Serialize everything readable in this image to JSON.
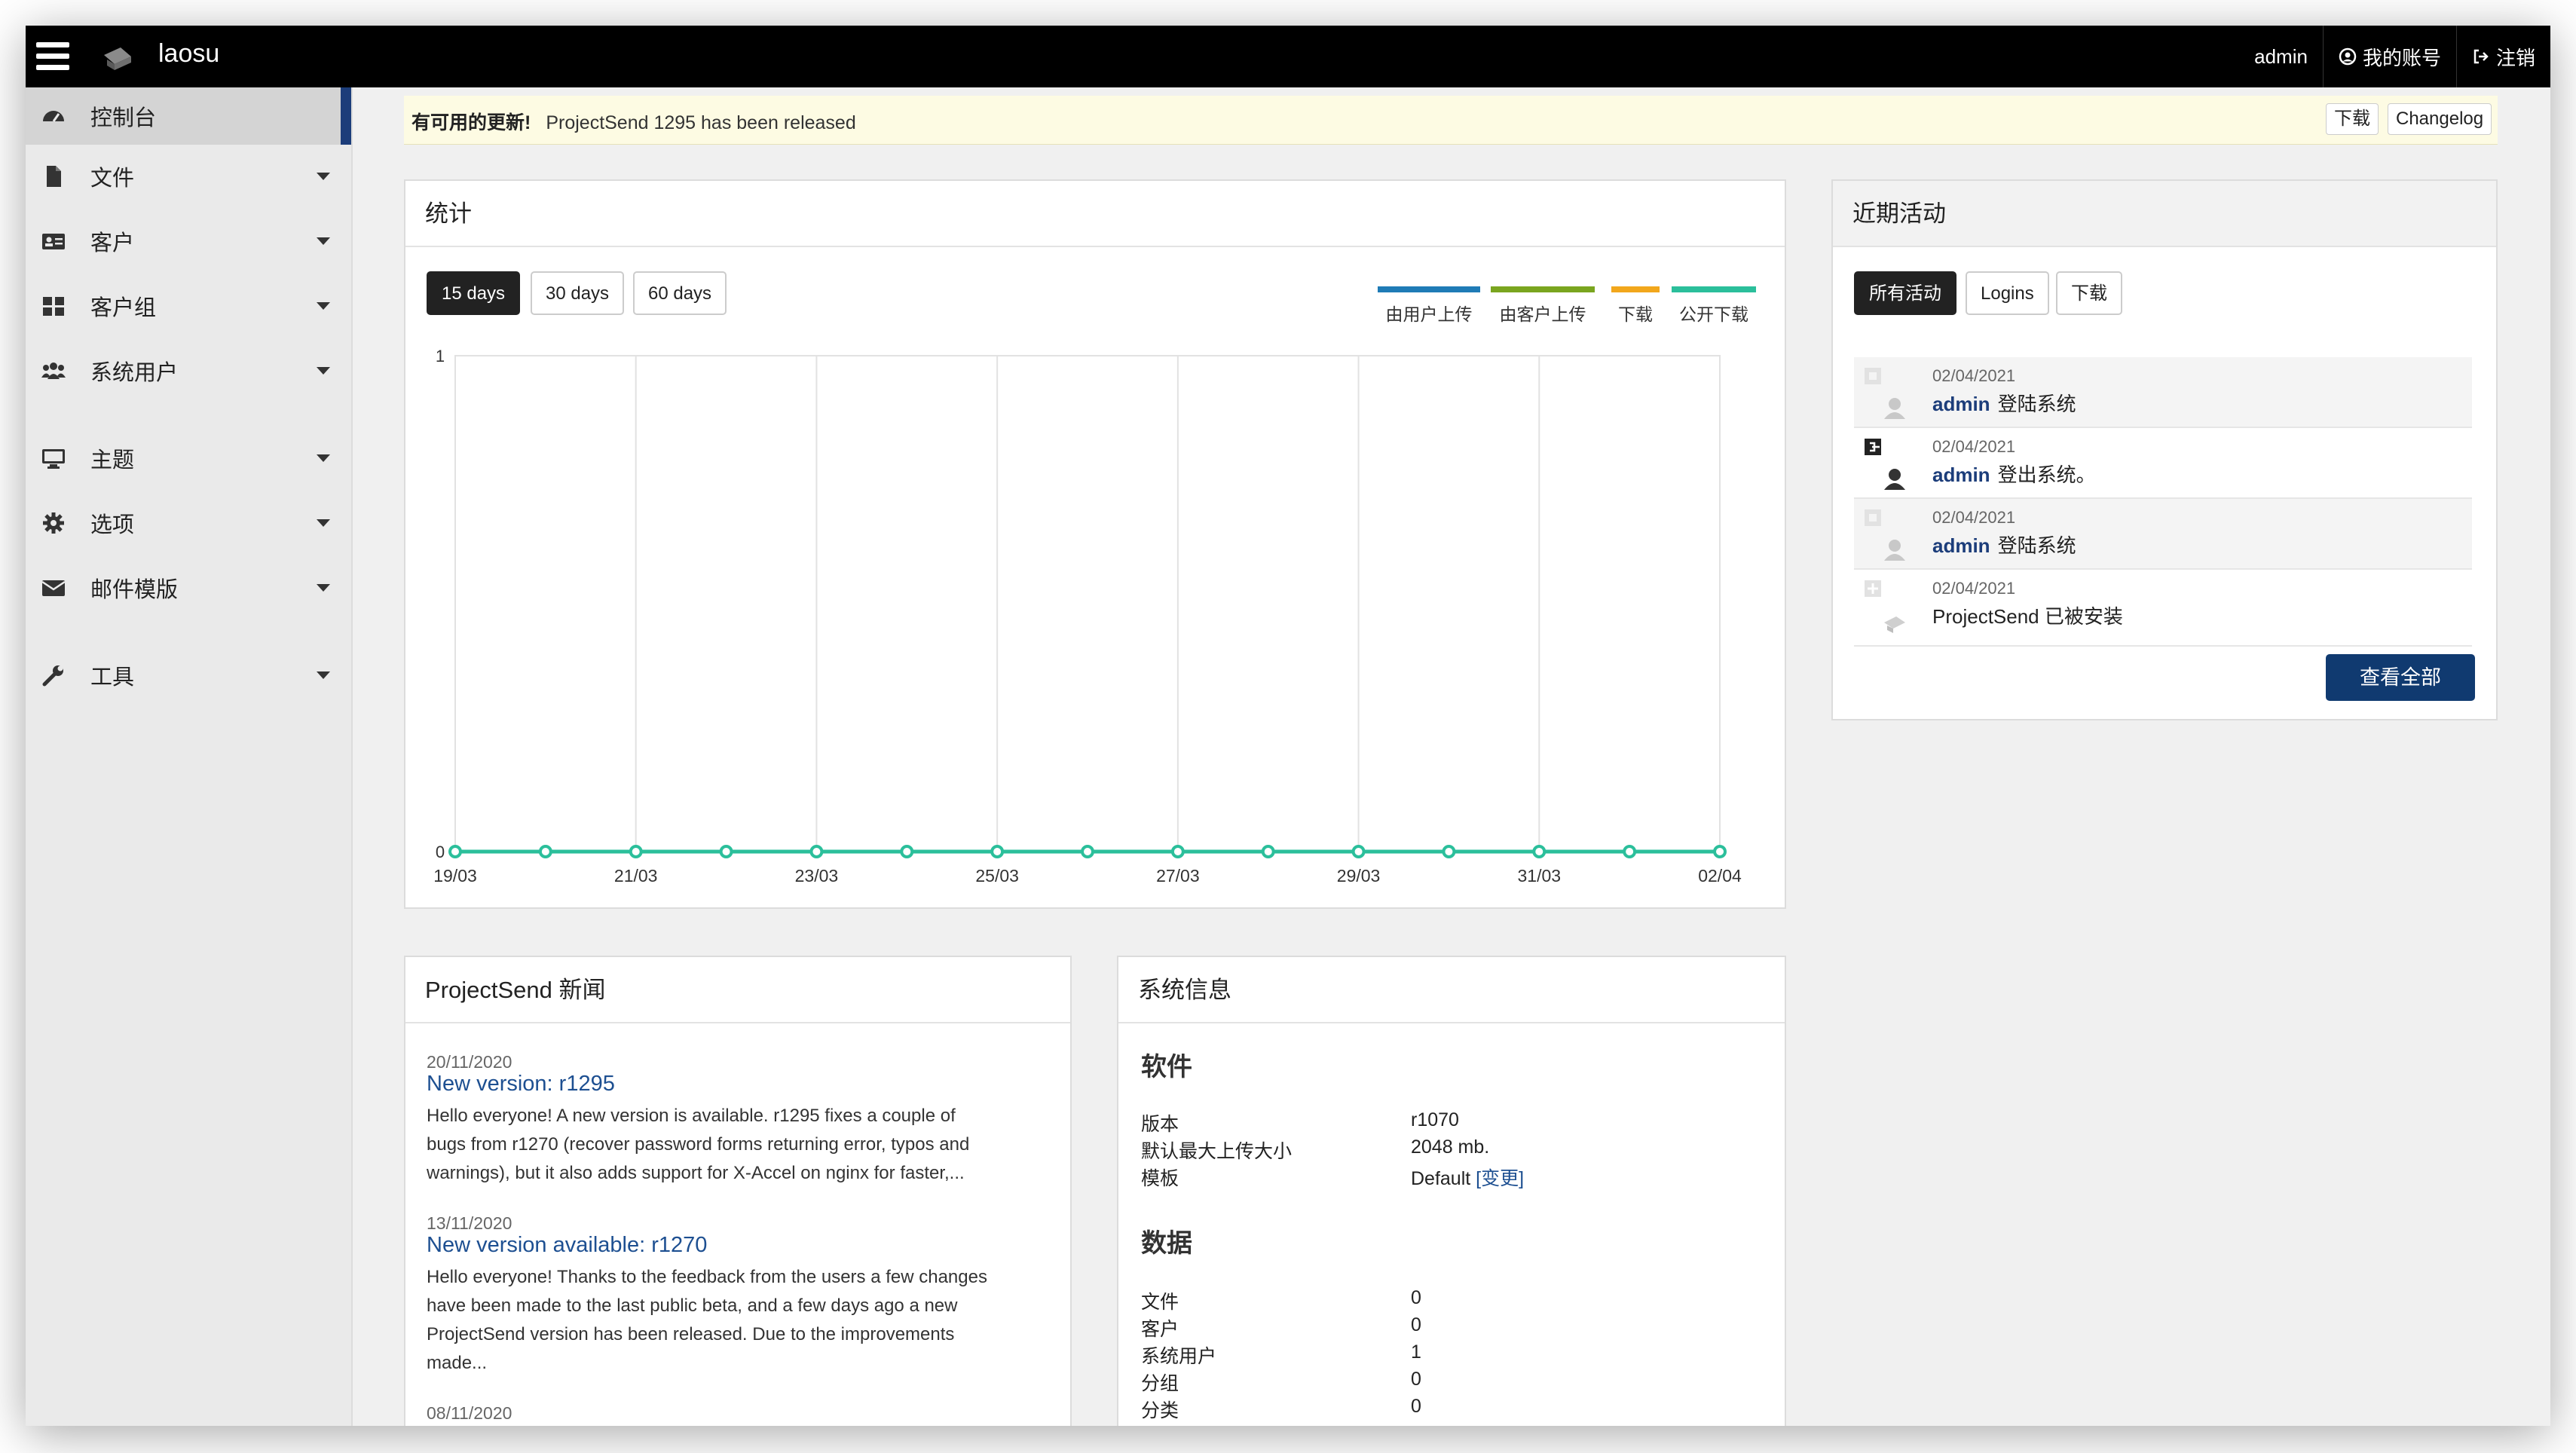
{
  "topbar": {
    "brand": "laosu",
    "user": "admin",
    "account": "我的账号",
    "logout": "注销"
  },
  "sidebar": {
    "items": [
      {
        "label": "控制台",
        "icon": "dashboard-icon"
      },
      {
        "label": "文件",
        "icon": "file-icon"
      },
      {
        "label": "客户",
        "icon": "id-card-icon"
      },
      {
        "label": "客户组",
        "icon": "grid-icon"
      },
      {
        "label": "系统用户",
        "icon": "users-icon"
      },
      {
        "label": "主题",
        "icon": "monitor-icon"
      },
      {
        "label": "选项",
        "icon": "gear-icon"
      },
      {
        "label": "邮件模版",
        "icon": "envelope-icon"
      },
      {
        "label": "工具",
        "icon": "wrench-icon"
      }
    ]
  },
  "update": {
    "title": "有可用的更新!",
    "message": "ProjectSend 1295 has been released",
    "download": "下载",
    "changelog": "Changelog"
  },
  "stats": {
    "title": "统计",
    "ranges": [
      "15 days",
      "30 days",
      "60 days"
    ],
    "legend": [
      {
        "label": "由用户上传",
        "color": "#1f7bb6"
      },
      {
        "label": "由客户上传",
        "color": "#7aa51f"
      },
      {
        "label": "下载",
        "color": "#f2a71c"
      },
      {
        "label": "公开下载",
        "color": "#2bbf9b"
      }
    ]
  },
  "chart_data": {
    "type": "line",
    "x": [
      "19/03",
      "20/03",
      "21/03",
      "22/03",
      "23/03",
      "24/03",
      "25/03",
      "26/03",
      "27/03",
      "28/03",
      "29/03",
      "30/03",
      "31/03",
      "01/04",
      "02/04"
    ],
    "x_tick_labels": [
      "19/03",
      "21/03",
      "23/03",
      "25/03",
      "27/03",
      "29/03",
      "31/03",
      "02/04"
    ],
    "ylim": [
      0,
      1
    ],
    "y_ticks": [
      "0",
      "1"
    ],
    "grid": true,
    "legend_position": "top-right",
    "series": [
      {
        "name": "由用户上传",
        "color": "#1f7bb6",
        "values": [
          0,
          0,
          0,
          0,
          0,
          0,
          0,
          0,
          0,
          0,
          0,
          0,
          0,
          0,
          0
        ]
      },
      {
        "name": "由客户上传",
        "color": "#7aa51f",
        "values": [
          0,
          0,
          0,
          0,
          0,
          0,
          0,
          0,
          0,
          0,
          0,
          0,
          0,
          0,
          0
        ]
      },
      {
        "name": "下载",
        "color": "#f2a71c",
        "values": [
          0,
          0,
          0,
          0,
          0,
          0,
          0,
          0,
          0,
          0,
          0,
          0,
          0,
          0,
          0
        ]
      },
      {
        "name": "公开下载",
        "color": "#2bbf9b",
        "values": [
          0,
          0,
          0,
          0,
          0,
          0,
          0,
          0,
          0,
          0,
          0,
          0,
          0,
          0,
          0
        ]
      }
    ]
  },
  "activity": {
    "title": "近期活动",
    "tabs": [
      "所有活动",
      "Logins",
      "下载"
    ],
    "rows": [
      {
        "date": "02/04/2021",
        "user": "admin",
        "action": "登陆系统",
        "icon": "login-icon"
      },
      {
        "date": "02/04/2021",
        "user": "admin",
        "action": "登出系统。",
        "icon": "logout-icon"
      },
      {
        "date": "02/04/2021",
        "user": "admin",
        "action": "登陆系统",
        "icon": "login-icon"
      },
      {
        "date": "02/04/2021",
        "user": "",
        "action": "ProjectSend 已被安装",
        "icon": "install-icon"
      }
    ],
    "view_all": "查看全部"
  },
  "news": {
    "title": "ProjectSend 新闻",
    "items": [
      {
        "date": "20/11/2020",
        "title": "New version: r1295",
        "lines": [
          "Hello everyone! A new version is available. r1295 fixes a couple of",
          "bugs from r1270 (recover password forms returning error, typos and",
          "warnings), but it also adds support for X-Accel on nginx for faster,..."
        ]
      },
      {
        "date": "13/11/2020",
        "title": "New version available: r1270",
        "lines": [
          "Hello everyone! Thanks to the feedback from the users a few changes",
          "have been made to the last public beta, and a few days ago a new",
          "ProjectSend version has been released. Due to the improvements",
          "made..."
        ]
      },
      {
        "date": "08/11/2020"
      }
    ]
  },
  "sysinfo": {
    "title": "系统信息",
    "software_title": "软件",
    "software": [
      {
        "label": "版本",
        "value": "r1070"
      },
      {
        "label": "默认最大上传大小",
        "value": "2048 mb."
      },
      {
        "label": "模板",
        "value": "Default",
        "link": "[变更]"
      }
    ],
    "data_title": "数据",
    "data": [
      {
        "label": "文件",
        "value": "0"
      },
      {
        "label": "客户",
        "value": "0"
      },
      {
        "label": "系统用户",
        "value": "1"
      },
      {
        "label": "分组",
        "value": "0"
      },
      {
        "label": "分类",
        "value": "0"
      }
    ]
  }
}
